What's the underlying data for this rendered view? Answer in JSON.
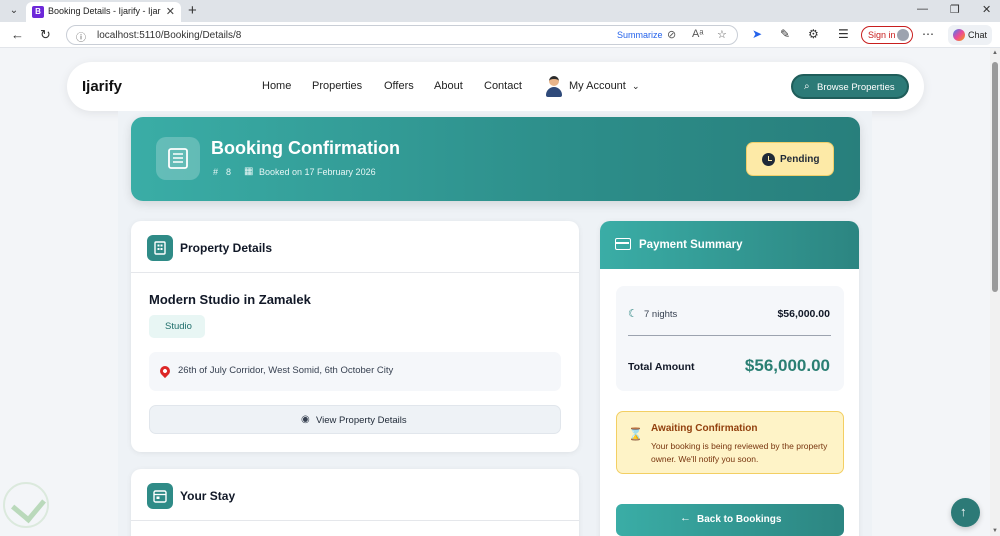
{
  "browser": {
    "tab_title": "Booking Details - Ijarify - Ijarify Re",
    "url": "localhost:5110/Booking/Details/8",
    "summarize": "Summarize",
    "signin": "Sign in",
    "chat": "Chat"
  },
  "navbar": {
    "brand": "Ijarify",
    "links": [
      "Home",
      "Properties",
      "Offers",
      "About",
      "Contact"
    ],
    "account": "My Account",
    "browse_button": "Browse Properties"
  },
  "header": {
    "title": "Booking Confirmation",
    "hash": "#",
    "booking_number": "8",
    "booked_on": "Booked on 17 February 2026",
    "status": "Pending"
  },
  "property": {
    "section_title": "Property Details",
    "name": "Modern Studio in Zamalek",
    "type": "Studio",
    "address": "26th of July Corridor, West Somid, 6th October City",
    "view_button": "View Property Details"
  },
  "stay": {
    "section_title": "Your Stay"
  },
  "payment": {
    "section_title": "Payment Summary",
    "nights_label": "7 nights",
    "nights_amount": "$56,000.00",
    "total_label": "Total Amount",
    "total_amount": "$56,000.00",
    "notice_title": "Awaiting Confirmation",
    "notice_text": "Your booking is being reviewed by the property owner. We'll notify you soon.",
    "back_button": "Back to Bookings"
  },
  "colors": {
    "primary": "#2c7a77",
    "accent_gradient_start": "#3aada6",
    "pending_bg": "#fdeaa7",
    "total_green": "#2a7f73"
  }
}
